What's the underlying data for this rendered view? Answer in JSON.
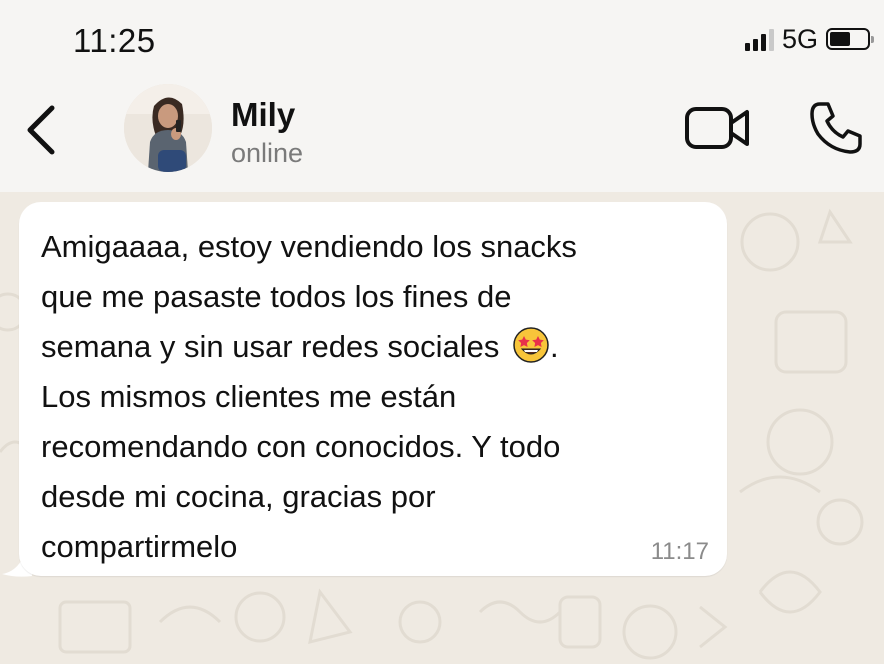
{
  "status_bar": {
    "time": "11:25",
    "network": "5G",
    "battery_level": 0.55
  },
  "header": {
    "contact_name": "Mily",
    "contact_status": "online",
    "back_icon": "chevron-left-icon",
    "video_icon": "video-camera-icon",
    "call_icon": "phone-icon"
  },
  "message": {
    "lines": [
      "Amigaaaa, estoy vendiendo los snacks",
      "que me pasaste todos los fines de",
      "semana y sin usar redes sociales",
      ".",
      "Los mismos clientes me están",
      "recomendando con conocidos. Y todo",
      "desde mi cocina, gracias por",
      "compartirmelo"
    ],
    "emoji": "star-struck-emoji",
    "time": "11:17"
  },
  "colors": {
    "background": "#f6f5f3",
    "chat_wallpaper": "#efeae2",
    "bubble": "#ffffff",
    "secondary_text": "#7a7a7a"
  }
}
